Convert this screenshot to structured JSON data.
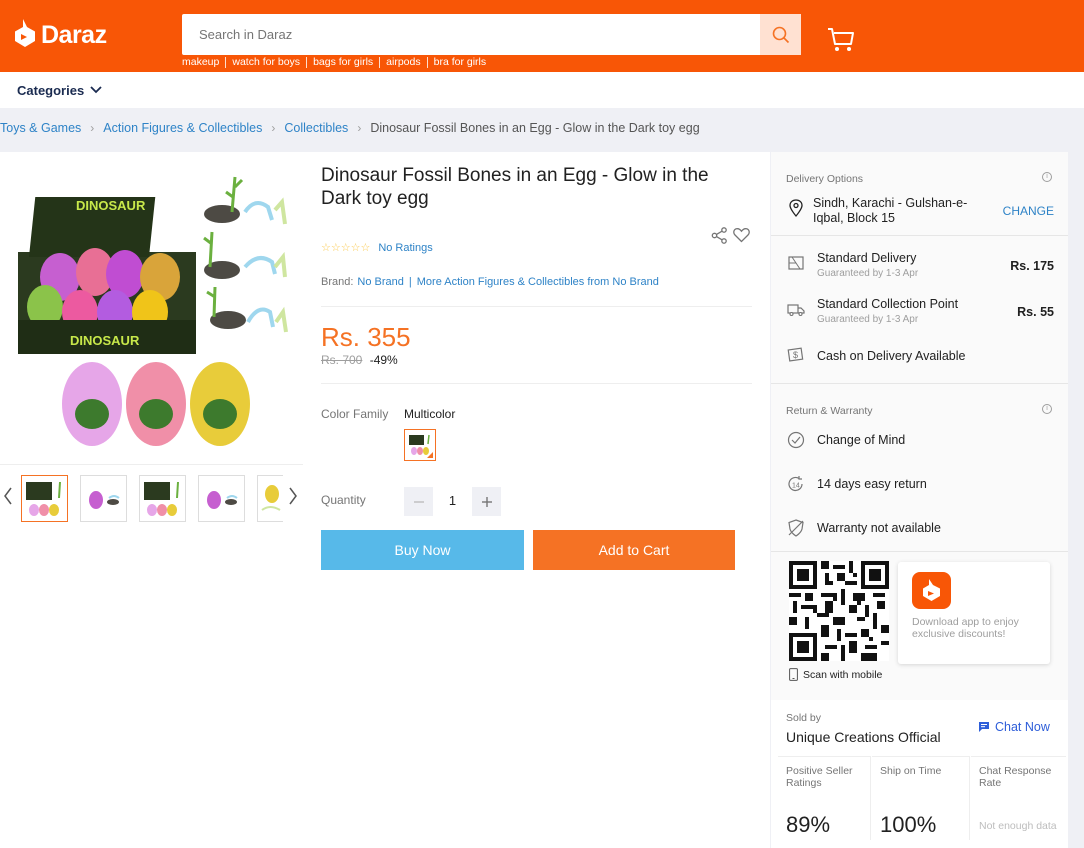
{
  "header": {
    "logo_text": "Daraz",
    "search_placeholder": "Search in Daraz",
    "hot_keywords": [
      "makeup",
      "watch for boys",
      "bags for girls",
      "airpods",
      "bra for girls"
    ]
  },
  "nav": {
    "categories_label": "Categories"
  },
  "breadcrumb": [
    "Toys & Games",
    "Action Figures & Collectibles",
    "Collectibles",
    "Dinosaur Fossil Bones in an Egg - Glow in the Dark toy egg"
  ],
  "product": {
    "title": "Dinosaur Fossil Bones in an Egg - Glow in the Dark toy egg",
    "stars": "☆☆☆☆☆",
    "ratings_text": "No Ratings",
    "brand_label": "Brand:",
    "brand_value": "No Brand",
    "more_from": "More Action Figures & Collectibles from No Brand",
    "price": "Rs. 355",
    "original_price": "Rs. 700",
    "discount": "-49%",
    "color_family_label": "Color Family",
    "color_family_value": "Multicolor",
    "quantity_label": "Quantity",
    "quantity": "1",
    "buy_now": "Buy Now",
    "add_to_cart": "Add to Cart"
  },
  "delivery": {
    "title": "Delivery Options",
    "location": "Sindh, Karachi - Gulshan-e-Iqbal, Block 15",
    "change": "CHANGE",
    "standard_delivery": "Standard Delivery",
    "standard_sub": "Guaranteed by 1-3 Apr",
    "standard_price": "Rs. 175",
    "collection": "Standard Collection Point",
    "collection_sub": "Guaranteed by 1-3 Apr",
    "collection_price": "Rs. 55",
    "cod": "Cash on Delivery Available"
  },
  "warranty": {
    "title": "Return & Warranty",
    "change_of_mind": "Change of Mind",
    "easy_return": "14 days easy return",
    "warranty": "Warranty not available",
    "return_days_badge": "14"
  },
  "app_promo": {
    "text": "Download app to enjoy exclusive discounts!",
    "scan": "Scan with mobile"
  },
  "seller": {
    "sold_by": "Sold by",
    "name": "Unique Creations Official",
    "chat": "Chat Now",
    "stats": [
      {
        "label": "Positive Seller Ratings",
        "value": "89%"
      },
      {
        "label": "Ship on Time",
        "value": "100%"
      },
      {
        "label": "Chat Response Rate",
        "value": "Not enough data"
      }
    ]
  },
  "colors": {
    "brand": "#f85606",
    "accent": "#f57224",
    "link": "#2e83c7",
    "buy": "#57b9e9"
  }
}
